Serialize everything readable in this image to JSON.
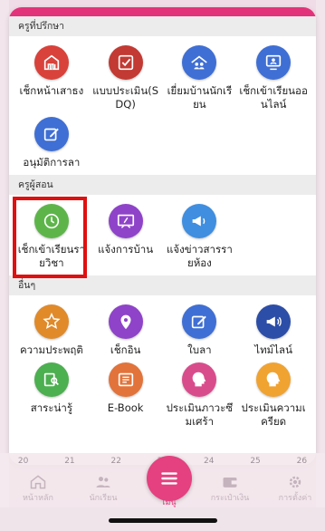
{
  "colors": {
    "accent": "#e2337a",
    "highlight": "#e01010"
  },
  "sections": [
    {
      "title": "ครูที่ปรึกษา",
      "items": [
        {
          "label": "เช็กหน้าเสาธง",
          "icon": "flag-house-icon",
          "color": "#d8423b"
        },
        {
          "label": "แบบประเมิน(SDQ)",
          "icon": "checkbox-icon",
          "color": "#c23a33"
        },
        {
          "label": "เยี่ยมบ้านนักเรียน",
          "icon": "home-visit-icon",
          "color": "#3f6fd4"
        },
        {
          "label": "เช็กเข้าเรียนออนไลน์",
          "icon": "online-check-icon",
          "color": "#3f6fd4"
        },
        {
          "label": "อนุมัติการลา",
          "icon": "edit-icon",
          "color": "#3f6fd4"
        }
      ]
    },
    {
      "title": "ครูผู้สอน",
      "items": [
        {
          "label": "เช็กเข้าเรียนรายวิชา",
          "icon": "clock-icon",
          "color": "#5db54a"
        },
        {
          "label": "แจ้งการบ้าน",
          "icon": "board-icon",
          "color": "#8e43c9"
        },
        {
          "label": "แจ้งข่าวสารรายห้อง",
          "icon": "megaphone-icon",
          "color": "#3f8ee0"
        }
      ]
    },
    {
      "title": "อื่นๆ",
      "items": [
        {
          "label": "ความประพฤติ",
          "icon": "star-icon",
          "color": "#e08a2a"
        },
        {
          "label": "เช็กอิน",
          "icon": "location-pin-icon",
          "color": "#8e43c9"
        },
        {
          "label": "ใบลา",
          "icon": "edit-icon",
          "color": "#3f6fd4"
        },
        {
          "label": "ไทม์ไลน์",
          "icon": "megaphone-icon",
          "color": "#2c4ea8"
        },
        {
          "label": "สาระน่ารู้",
          "icon": "search-book-icon",
          "color": "#4caf50"
        },
        {
          "label": "E-Book",
          "icon": "book-icon",
          "color": "#e2733a"
        },
        {
          "label": "ประเมินภาวะซึมเศร้า",
          "icon": "head-icon",
          "color": "#d94c8c"
        },
        {
          "label": "ประเมินความเครียด",
          "icon": "head-icon",
          "color": "#f0a331"
        }
      ]
    }
  ],
  "calendar_strip": [
    "20",
    "21",
    "22",
    "23",
    "24",
    "25",
    "26"
  ],
  "bottom_nav": {
    "home": "หน้าหลัก",
    "students": "นักเรียน",
    "menu": "เมนู",
    "wallet": "กระเป๋าเงิน",
    "settings": "การตั้งค่า"
  }
}
